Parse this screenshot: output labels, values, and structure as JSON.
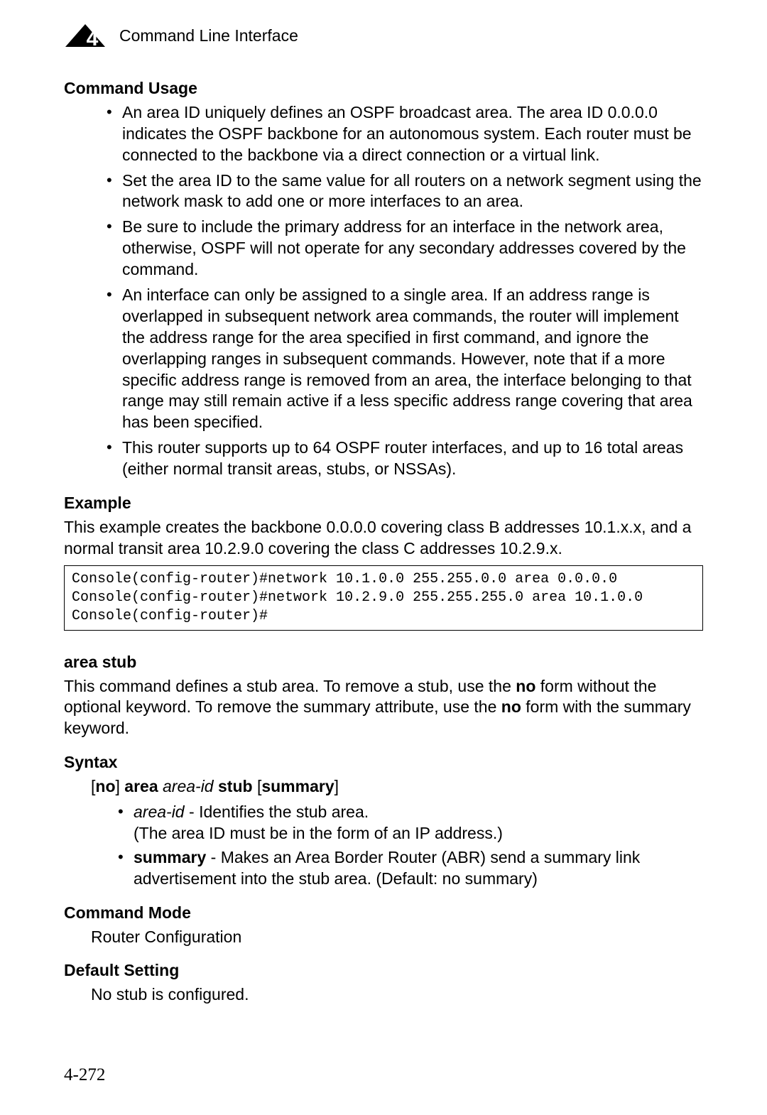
{
  "header": {
    "chapter_number": "4",
    "title": "Command Line Interface"
  },
  "sections": {
    "command_usage": {
      "heading": "Command Usage",
      "bullets": [
        "An area ID uniquely defines an OSPF broadcast area. The area ID 0.0.0.0 indicates the OSPF backbone for an autonomous system. Each router must be connected to the backbone via a direct connection or a virtual link.",
        "Set the area ID to the same value for all routers on a network segment using the network mask to add one or more interfaces to an area.",
        "Be sure to include the primary address for an interface in the network area, otherwise, OSPF will not operate for any secondary addresses covered by the command.",
        "An interface can only be assigned to a single area. If an address range is overlapped in subsequent network area commands, the router will implement the address range for the area specified in first command, and ignore the overlapping ranges in subsequent commands. However, note that if a more specific address range is removed from an area, the interface belonging to that range may still remain active if a less specific address range covering that area has been specified.",
        "This router supports up to 64 OSPF router interfaces, and up to 16 total areas (either normal transit areas, stubs, or NSSAs)."
      ]
    },
    "example": {
      "heading": "Example",
      "intro": "This example creates the backbone 0.0.0.0 covering class B addresses 10.1.x.x, and a normal transit area 10.2.9.0 covering the class C addresses 10.2.9.x.",
      "code": "Console(config-router)#network 10.1.0.0 255.255.0.0 area 0.0.0.0\nConsole(config-router)#network 10.2.9.0 255.255.255.0 area 10.1.0.0\nConsole(config-router)#"
    },
    "area_stub": {
      "heading": "area stub",
      "desc_parts": {
        "p1": "This command defines a stub area. To remove a stub, use the ",
        "no1": "no",
        "p2": " form without the optional keyword. To remove the summary attribute, use the ",
        "no2": "no",
        "p3": " form with the summary keyword."
      },
      "syntax": {
        "heading": "Syntax",
        "line": {
          "lb1": "[",
          "no": "no",
          "rb1": "] ",
          "area": "area",
          "sp1": " ",
          "areaid": "area-id",
          "sp2": " ",
          "stub": "stub",
          "sp3": " ",
          "lb2": "[",
          "summary": "summary",
          "rb2": "]"
        },
        "items": {
          "area_id": {
            "term": "area-id",
            "sep": " - ",
            "desc": "Identifies the stub area.",
            "desc2": "(The area ID must be in the form of an IP address.)"
          },
          "summary": {
            "term": "summary",
            "sep": " - ",
            "desc": "Makes an Area Border Router (ABR) send a summary link advertisement into the stub area. (Default: no summary)"
          }
        }
      },
      "command_mode": {
        "heading": "Command Mode",
        "value": "Router Configuration"
      },
      "default_setting": {
        "heading": "Default Setting",
        "value": "No stub is configured."
      }
    }
  },
  "page_number": "4-272"
}
